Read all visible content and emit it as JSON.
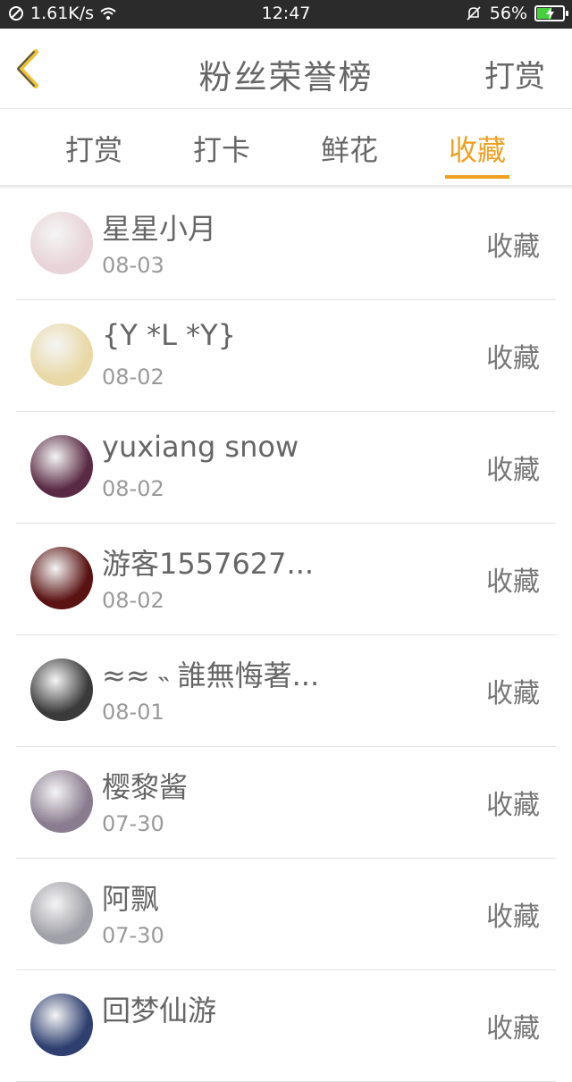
{
  "status_bar": {
    "speed": "1.61K/s",
    "time": "12:47",
    "battery": "56%",
    "battery_level": 0.56
  },
  "header": {
    "title": "粉丝荣誉榜",
    "action": "打赏"
  },
  "tabs": [
    {
      "label": "打赏",
      "active": false
    },
    {
      "label": "打卡",
      "active": false
    },
    {
      "label": "鲜花",
      "active": false
    },
    {
      "label": "收藏",
      "active": true
    }
  ],
  "list": [
    {
      "name": "星星小月",
      "date": "08-03",
      "action": "收藏",
      "avatar_color": "#e8d4d8"
    },
    {
      "name": "{Y *L *Y}",
      "date": "08-02",
      "action": "收藏",
      "avatar_color": "#e9d9a7"
    },
    {
      "name": "yuxiang snow",
      "date": "08-02",
      "action": "收藏",
      "avatar_color": "#5a2a44"
    },
    {
      "name": "游客1557627...",
      "date": "08-02",
      "action": "收藏",
      "avatar_color": "#5a1212"
    },
    {
      "name": "≈≈ ˵ 誰無悔著...",
      "date": "08-01",
      "action": "收藏",
      "avatar_color": "#3a3a3a"
    },
    {
      "name": "樱黎酱",
      "date": "07-30",
      "action": "收藏",
      "avatar_color": "#8a7c8f"
    },
    {
      "name": "阿飘",
      "date": "07-30",
      "action": "收藏",
      "avatar_color": "#a0a0a8"
    },
    {
      "name": "回梦仙游",
      "date": "",
      "action": "收藏",
      "avatar_color": "#2e3f70"
    }
  ]
}
